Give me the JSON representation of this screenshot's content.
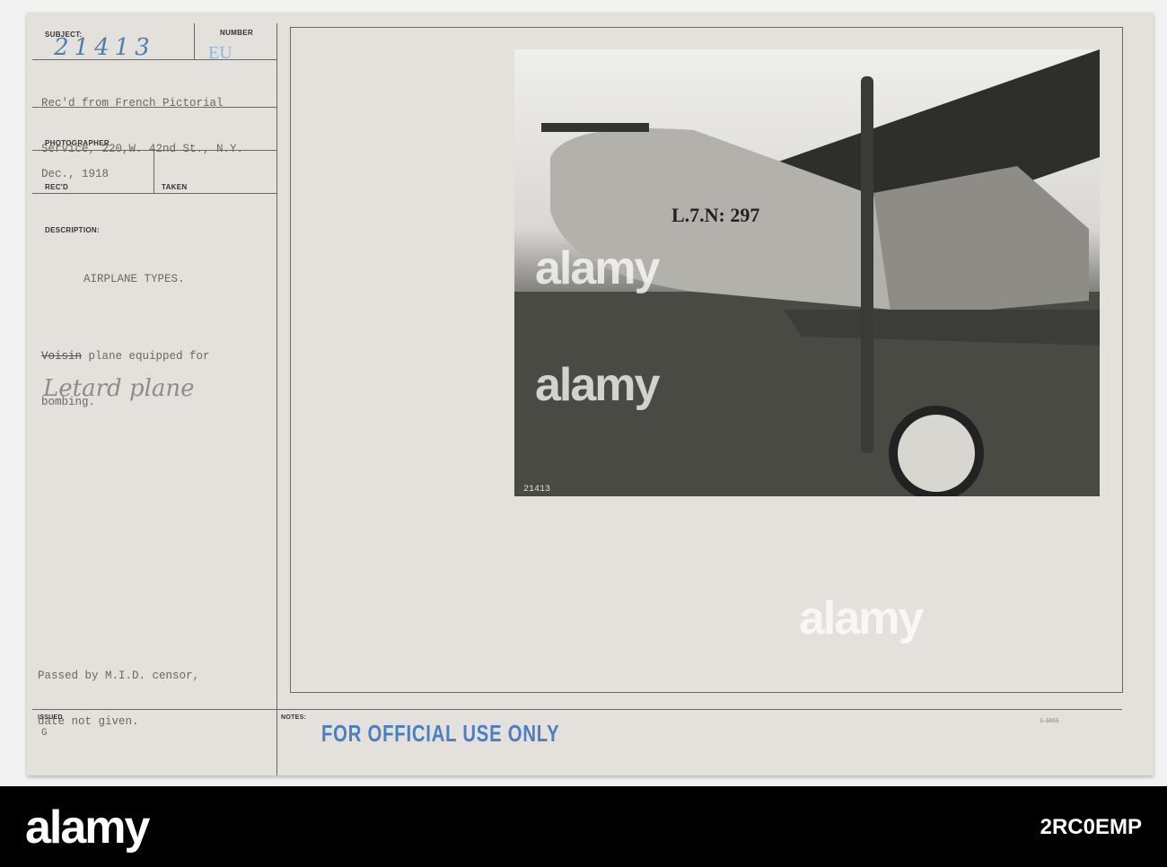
{
  "card": {
    "subject_label": "SUBJECT:",
    "subject_value": "21413",
    "number_label": "NUMBER",
    "number_value": "EU",
    "received_from": [
      "Rec'd from French Pictorial",
      "Service, 220,W. 42nd St., N.Y."
    ],
    "photographer_label": "PHOTOGRAPHER",
    "recd_value": "Dec., 1918",
    "recd_label": "REC'D",
    "taken_label": "TAKEN",
    "description_label": "DESCRIPTION:",
    "description_title": "AIRPLANE TYPES.",
    "description_struck": "Voisin",
    "description_lines": [
      " plane equipped for",
      "bombing."
    ],
    "handwritten_note": "Letard plane",
    "censor_lines": [
      "Passed by M.I.D. censor,",
      "date not given."
    ],
    "issued_label": "ISSUED",
    "issued_value": "G",
    "notes_label": "NOTES:",
    "form_number": "3—5055",
    "stamp": "FOR OFFICIAL USE ONLY"
  },
  "photo": {
    "fuselage_marking": "L.7.N: 297",
    "negative_number": "21413"
  },
  "watermark": {
    "brand": "alamy",
    "image_id": "2RC0EMP"
  },
  "colors": {
    "card": "#e4e0dc",
    "stamp": "#4a7fc4",
    "pencil": "#5b8ab5"
  }
}
